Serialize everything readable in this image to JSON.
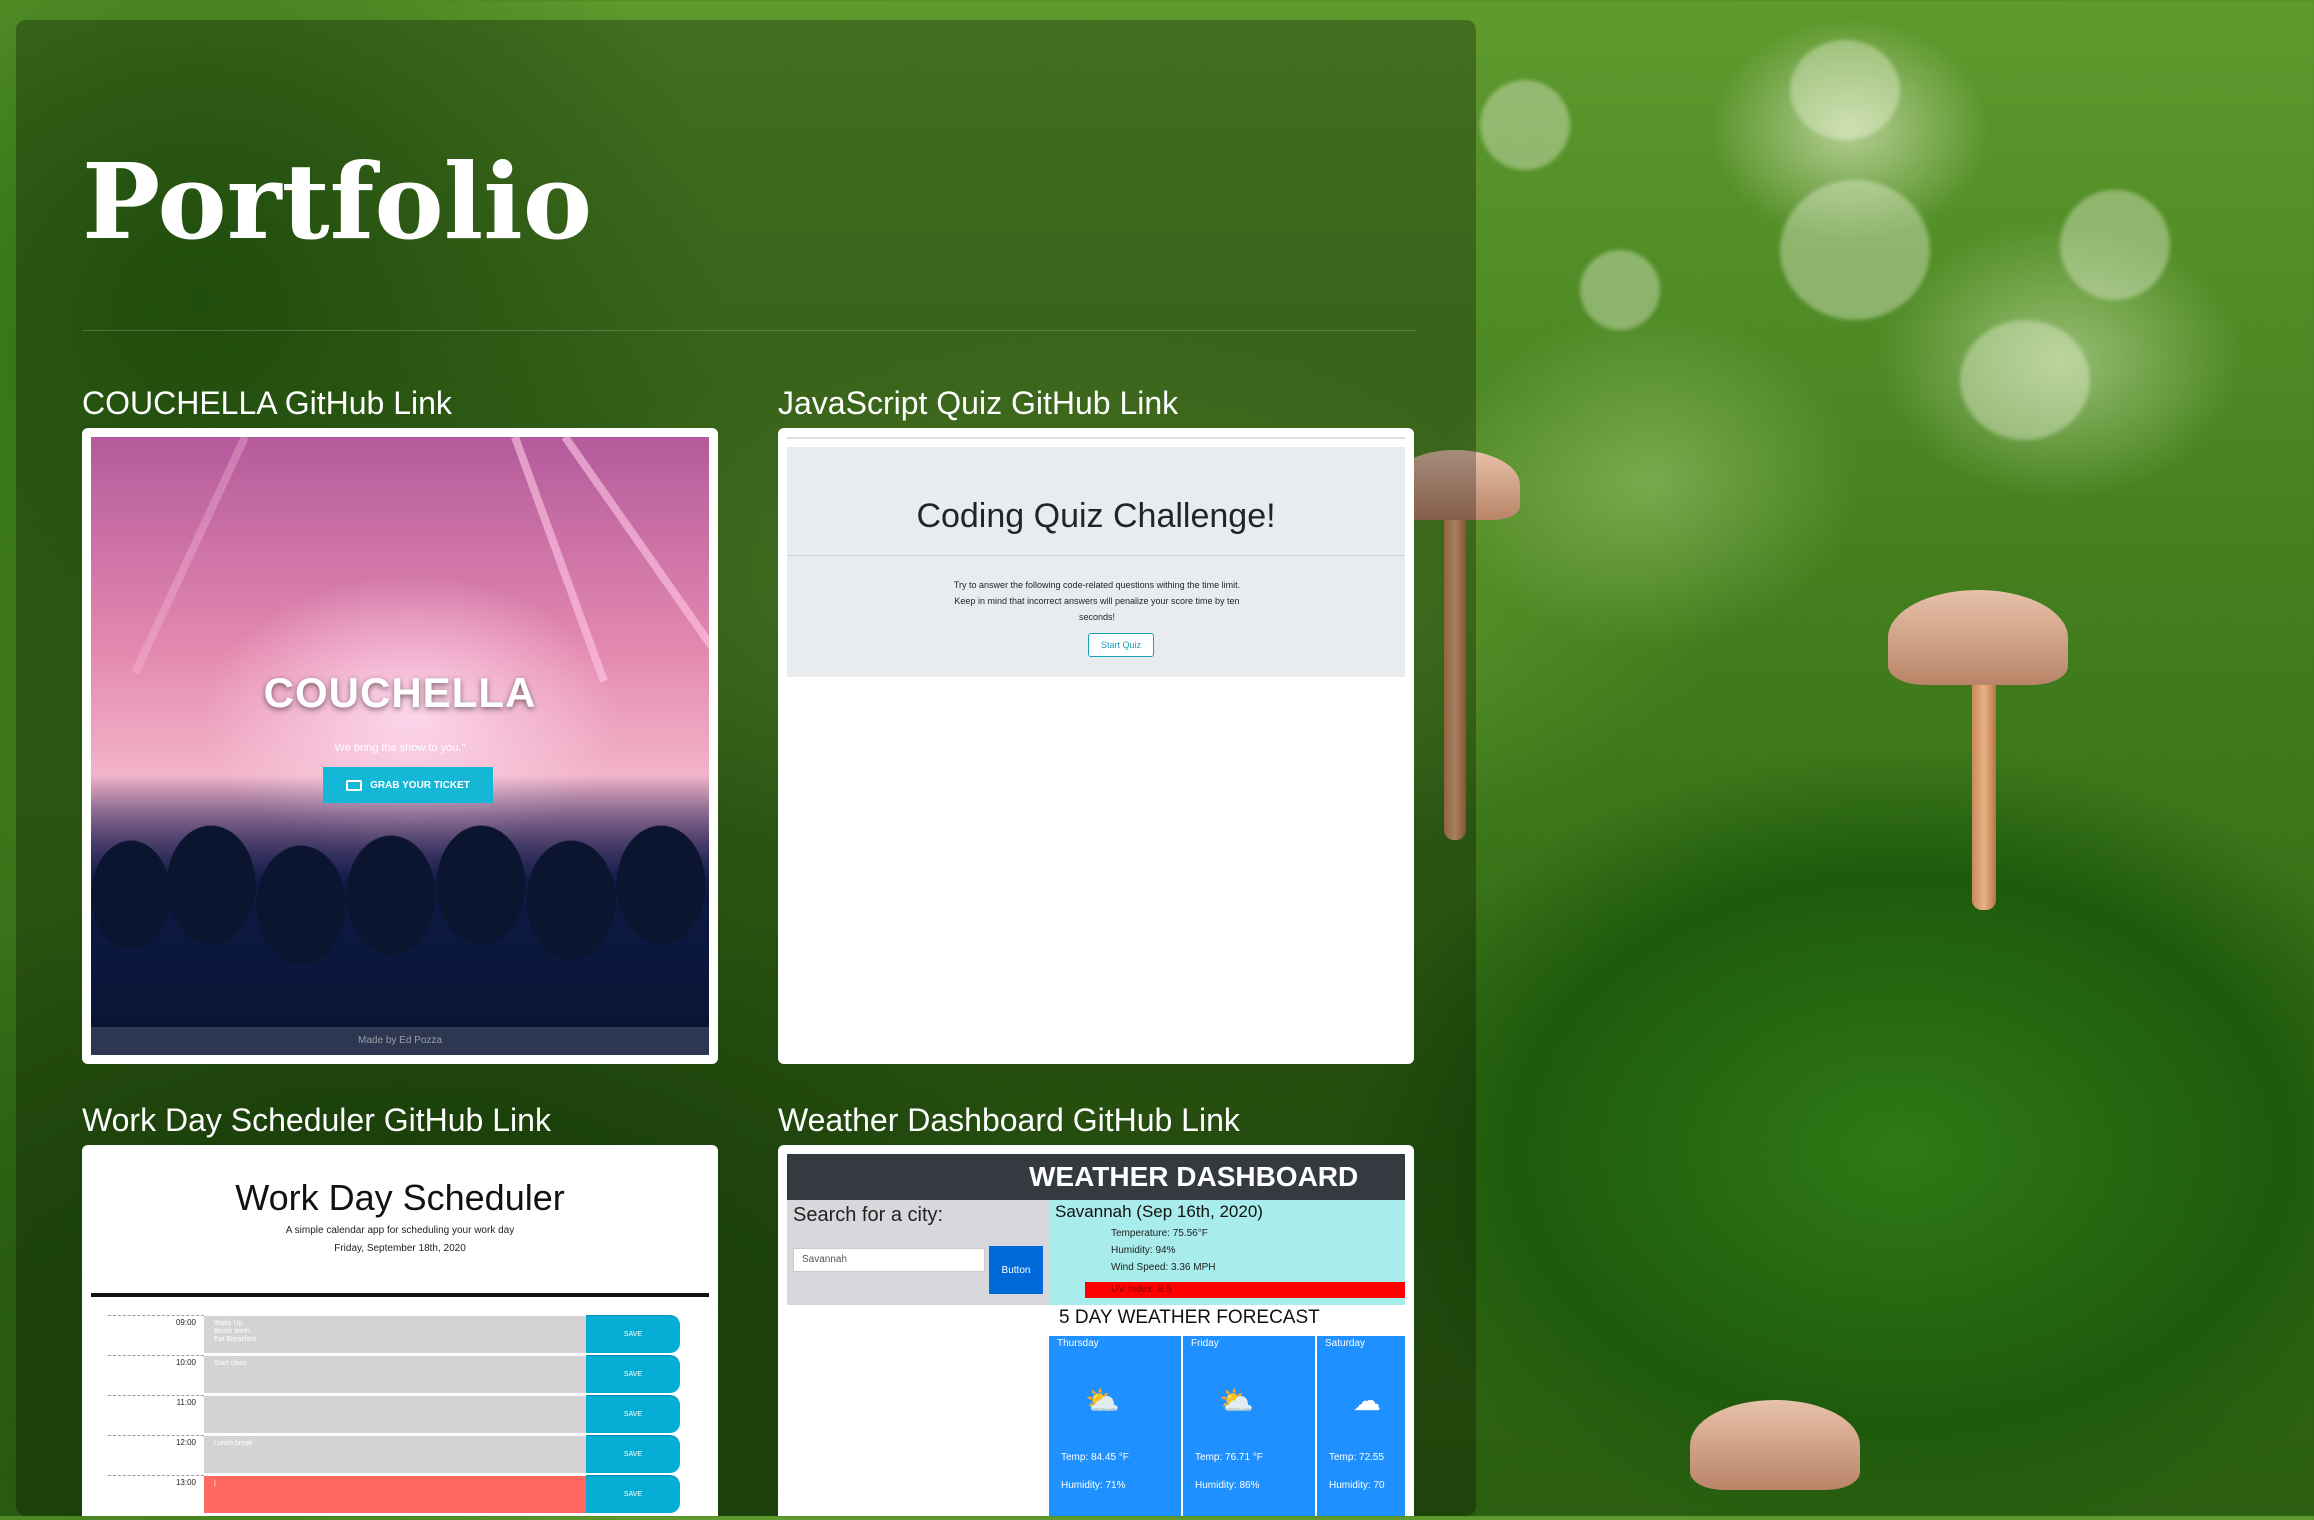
{
  "page": {
    "title": "Portfolio"
  },
  "projects": [
    {
      "link_label": "COUCHELLA GitHub Link",
      "preview": {
        "title": "COUCHELLA",
        "tagline": "We bring the show to you.\"",
        "button": "GRAB YOUR TICKET",
        "footer": "Made by Ed Pozza"
      }
    },
    {
      "link_label": "JavaScript Quiz GitHub Link",
      "preview": {
        "title": "Coding Quiz Challenge!",
        "text": "Try to answer the following code-related questions withing the time limit. Keep in mind that incorrect answers will penalize your score time by ten seconds!",
        "button": "Start Quiz"
      }
    },
    {
      "link_label": "Work Day Scheduler GitHub Link",
      "preview": {
        "title": "Work Day Scheduler",
        "subtitle": "A simple calendar app for scheduling your work day",
        "date": "Friday, September 18th, 2020",
        "save_label": "SAVE",
        "rows": [
          {
            "hour": "09:00",
            "text": "Wake Up\nBrush teeth\nEat Breakfast",
            "state": "past"
          },
          {
            "hour": "10:00",
            "text": "Start class",
            "state": "past"
          },
          {
            "hour": "11:00",
            "text": "",
            "state": "past"
          },
          {
            "hour": "12:00",
            "text": "Lunch break",
            "state": "past"
          },
          {
            "hour": "13:00",
            "text": "|",
            "state": "present"
          }
        ]
      }
    },
    {
      "link_label": "Weather Dashboard GitHub Link",
      "preview": {
        "header": "WEATHER DASHBOARD",
        "search_label": "Search for a city:",
        "search_value": "Savannah",
        "button": "Button",
        "city": "Savannah (Sep 16th, 2020)",
        "temperature": "Temperature: 75.56°F",
        "humidity": "Humidity: 94%",
        "wind": "Wind Speed: 3.36 MPH",
        "uv": "UV Index: 8.5",
        "forecast_title": "5 DAY WEATHER FORECAST",
        "forecast": [
          {
            "day": "Thursday",
            "temp": "Temp: 84.45 °F",
            "humidity": "Humidity: 71%",
            "icon": "partly-cloudy-icon"
          },
          {
            "day": "Friday",
            "temp": "Temp: 76.71 °F",
            "humidity": "Humidity: 86%",
            "icon": "partly-cloudy-icon"
          },
          {
            "day": "Saturday",
            "temp": "Temp: 72.55",
            "humidity": "Humidity: 70",
            "icon": "cloud-icon"
          }
        ]
      }
    }
  ]
}
